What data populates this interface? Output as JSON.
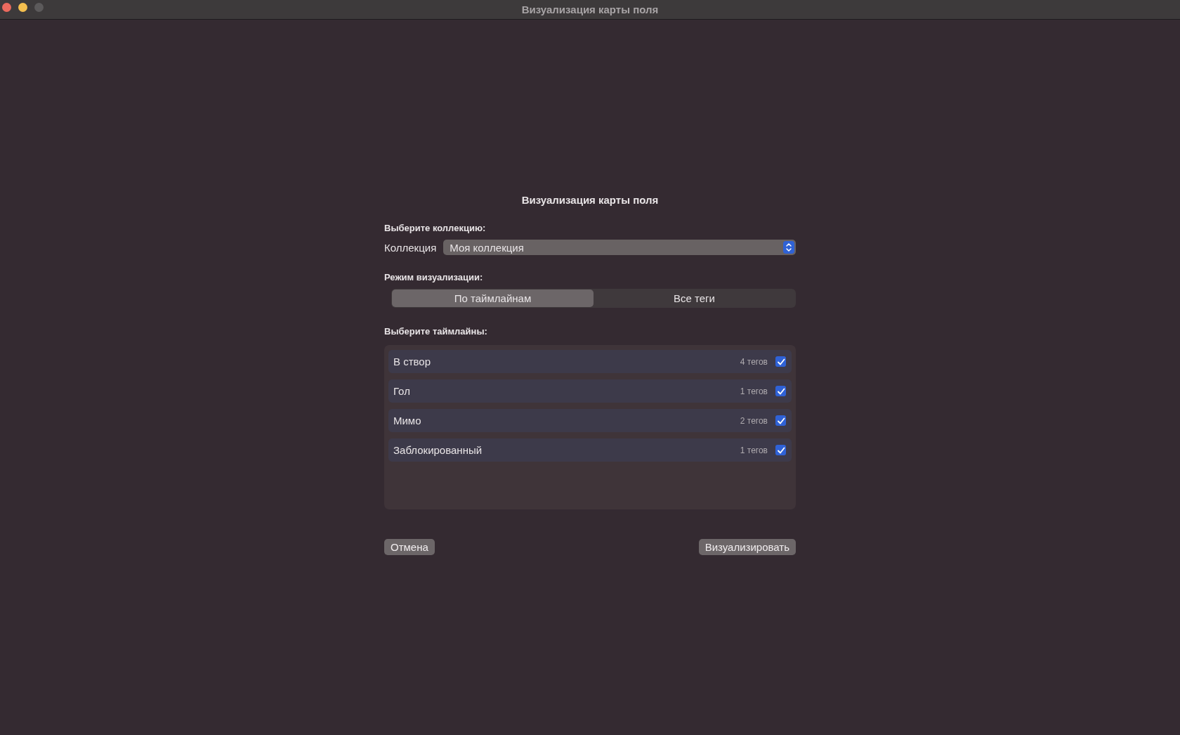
{
  "window": {
    "title": "Визуализация карты поля"
  },
  "dialog": {
    "title": "Визуализация карты поля",
    "collection_section": "Выберите коллекцию:",
    "collection": {
      "label": "Коллекция",
      "value": "Моя коллекция"
    },
    "mode_section": "Режим визуализации:",
    "modes": [
      {
        "label": "По таймлайнам",
        "selected": true
      },
      {
        "label": "Все теги",
        "selected": false
      }
    ],
    "timelines_section": "Выберите таймлайны:",
    "timelines": [
      {
        "name": "В створ",
        "count": "4 тегов",
        "checked": true
      },
      {
        "name": "Гол",
        "count": "1 тегов",
        "checked": true
      },
      {
        "name": "Мимо",
        "count": "2 тегов",
        "checked": true
      },
      {
        "name": "Заблокированный",
        "count": "1 тегов",
        "checked": true
      }
    ],
    "buttons": {
      "cancel": "Отмена",
      "confirm": "Визуализировать"
    }
  }
}
